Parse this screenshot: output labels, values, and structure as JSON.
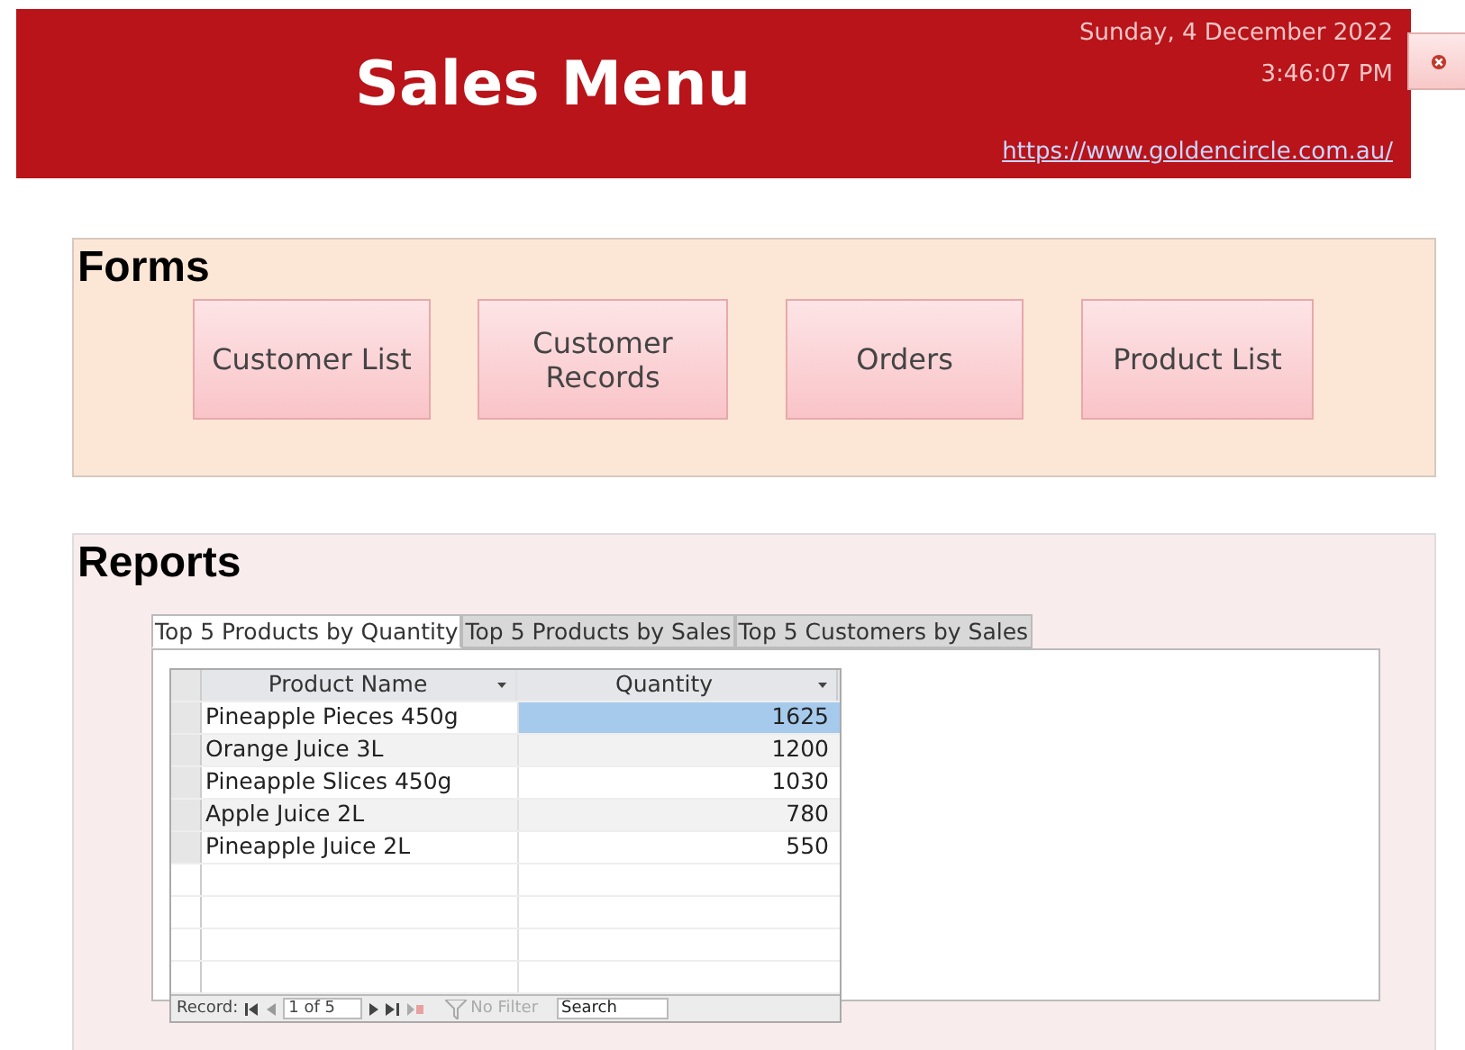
{
  "header": {
    "title": "Sales Menu",
    "date": "Sunday, 4 December 2022",
    "time": "3:46:07 PM",
    "link": "https://www.goldencircle.com.au/"
  },
  "forms": {
    "heading": "Forms",
    "buttons": [
      "Customer List",
      "Customer Records",
      "Orders",
      "Product List"
    ]
  },
  "reports": {
    "heading": "Reports",
    "tabs": [
      {
        "label": "Top 5 Products by Quantity",
        "selected": true
      },
      {
        "label": "Top 5 Products by Sales",
        "selected": false
      },
      {
        "label": "Top 5 Customers by Sales",
        "selected": false
      }
    ],
    "table": {
      "columns": [
        "Product Name",
        "Quantity"
      ],
      "rows": [
        {
          "cells": [
            "Pineapple Pieces 450g",
            "1625"
          ],
          "selected": true
        },
        {
          "cells": [
            "Orange Juice 3L",
            "1200"
          ],
          "selected": false
        },
        {
          "cells": [
            "Pineapple Slices 450g",
            "1030"
          ],
          "selected": false
        },
        {
          "cells": [
            "Apple Juice 2L",
            "780"
          ],
          "selected": false
        },
        {
          "cells": [
            "Pineapple Juice 2L",
            "550"
          ],
          "selected": false
        }
      ]
    },
    "navigation": {
      "label": "Record:",
      "position": "1 of 5",
      "filter": "No Filter",
      "search": "Search"
    }
  }
}
